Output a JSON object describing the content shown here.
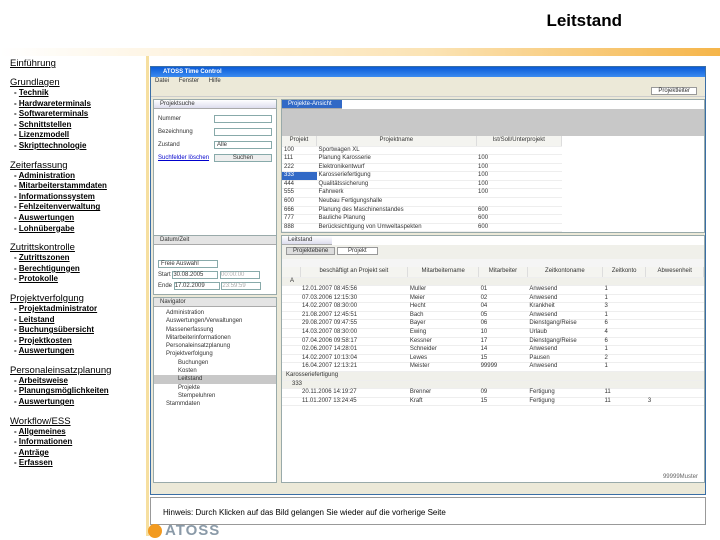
{
  "page_title": "Leitstand",
  "nav": [
    {
      "title": "Einführung",
      "items": []
    },
    {
      "title": "Grundlagen",
      "items": [
        "Technik",
        "Hardwareterminals",
        "Softwareterminals",
        "Schnittstellen",
        "Lizenzmodell",
        "Skripttechnologie"
      ]
    },
    {
      "title": "Zeiterfassung",
      "items": [
        "Administration",
        "Mitarbeiterstammdaten",
        "Informationssystem",
        "Fehlzeitenverwaltung",
        "Auswertungen",
        "Lohnübergabe"
      ]
    },
    {
      "title": "Zutrittskontrolle",
      "items": [
        "Zutrittszonen",
        "Berechtigungen",
        "Protokolle"
      ]
    },
    {
      "title": "Projektverfolgung",
      "items": [
        "Projektadministrator",
        "Leitstand",
        "Buchungsübersicht",
        "Projektkosten",
        "Auswertungen"
      ]
    },
    {
      "title": "Personaleinsatzplanung",
      "items": [
        "Arbeitsweise",
        "Planungsmöglichkeiten",
        "Auswertungen"
      ]
    },
    {
      "title": "Workflow/ESS",
      "items": [
        "Allgemeines",
        "Informationen",
        "Anträge",
        "Erfassen"
      ]
    }
  ],
  "app": {
    "window_title": "ATOSS Time Control",
    "menu": [
      "Datei",
      "Fenster",
      "Hilfe"
    ],
    "perspective": "Projektleiter",
    "search": {
      "tab": "Projektsuche",
      "nummer": "Nummer",
      "bezeichnung": "Bezeichnung",
      "zustand": "Zustand",
      "zustand_value": "Alle",
      "reset": "Suchfelder löschen",
      "search": "Suchen"
    },
    "projects": {
      "tab": "Projekte-Ansicht",
      "headers": [
        "Projekt",
        "Projektname",
        "Ist/Soll/Unterprojekt"
      ],
      "rows": [
        [
          "100",
          "Sportwagen XL",
          ""
        ],
        [
          "111",
          "Planung Karosserie",
          "100"
        ],
        [
          "222",
          "Elektronikentwurf",
          "100"
        ],
        [
          "333",
          "Karosseriefertigung",
          "100"
        ],
        [
          "444",
          "Qualitätssicherung",
          "100"
        ],
        [
          "555",
          "Fahrwerk",
          "100"
        ],
        [
          "600",
          "Neubau Fertigungshalle",
          ""
        ],
        [
          "666",
          "Planung des Maschinenstandes",
          "600"
        ],
        [
          "777",
          "Bauliche Planung",
          "600"
        ],
        [
          "888",
          "Berücksichtigung von Umweltaspekten",
          "600"
        ]
      ]
    },
    "datetime": {
      "tab": "Datum/Zeit",
      "select": "Freie Auswahl",
      "start_label": "Start",
      "start": "30.08.2005",
      "end_label": "Ende",
      "end": "17.02.2009",
      "start_time": "00:00:00",
      "end_time": "23:59:59"
    },
    "navigator": {
      "tab": "Navigator",
      "items": [
        "Administration",
        "Auswertungen/Verwaltungen",
        "Massenerfassung",
        "Mitarbeiterinformationen",
        "Personaleinsatzplanung",
        "Projektverfolgung"
      ],
      "sub": [
        "Buchungen",
        "Kosten",
        "Leitstand",
        "Projekte",
        "Stempeluhren"
      ],
      "last": "Stammdaten"
    },
    "leitstand": {
      "tab": "Leitstand",
      "subtabs": [
        "Projektebene",
        "Projekt"
      ],
      "headers": [
        "beschäftigt an Projekt seit",
        "Mitarbeitername",
        "Mitarbeiter",
        "Zeitkontoname",
        "Zeitkonto",
        "Abwesenheit"
      ],
      "group1": "A",
      "rows1": [
        [
          "12.01.2007 08:45:56",
          "Muller",
          "01",
          "Anwesend",
          "1",
          ""
        ],
        [
          "07.03.2006 12:15:30",
          "Meier",
          "02",
          "Anwesend",
          "1",
          ""
        ],
        [
          "14.02.2007 08:30:00",
          "Hecht",
          "04",
          "Krankheit",
          "3",
          ""
        ],
        [
          "21.08.2007 12:45:51",
          "Bach",
          "05",
          "Anwesend",
          "1",
          ""
        ],
        [
          "29.08.2007 09:47:55",
          "Bayer",
          "06",
          "Dienstgang/Reise",
          "6",
          ""
        ],
        [
          "14.03.2007 08:30:00",
          "Ewing",
          "10",
          "Urlaub",
          "4",
          ""
        ],
        [
          "07.04.2006 09:58:17",
          "Kessner",
          "17",
          "Dienstgang/Reise",
          "6",
          ""
        ],
        [
          "02.06.2007 14:28:01",
          "Schneider",
          "14",
          "Anwesend",
          "1",
          ""
        ],
        [
          "14.02.2007 10:13:04",
          "Lewes",
          "15",
          "Pausen",
          "2",
          ""
        ],
        [
          "16.04.2007 12:13:21",
          "Meister",
          "99999",
          "Anwesend",
          "1",
          ""
        ]
      ],
      "group2": "Karosseriefertigung",
      "sub2": "333",
      "rows2": [
        [
          "20.11.2006 14:19:27",
          "Brenner",
          "09",
          "Fertigung",
          "11",
          ""
        ],
        [
          "11.01.2007 13:24:45",
          "Kraft",
          "15",
          "Fertigung",
          "11",
          "3"
        ]
      ],
      "status": "99999Muster"
    }
  },
  "hint": "Hinweis: Durch Klicken auf das Bild gelangen Sie wieder auf die vorherige Seite",
  "logo": "ATOSS"
}
